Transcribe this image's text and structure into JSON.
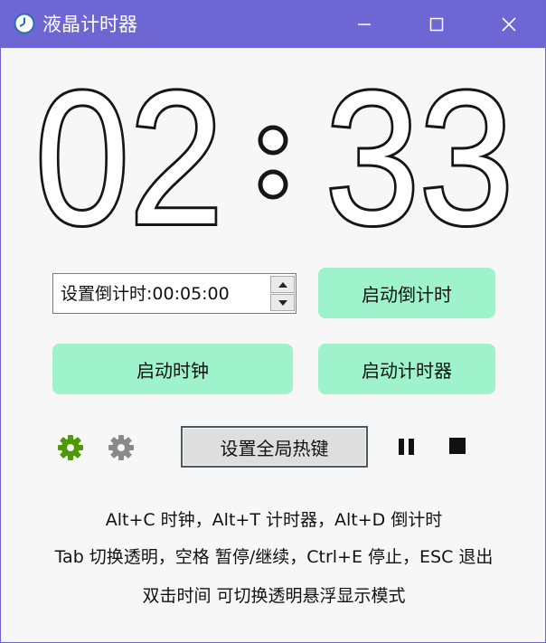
{
  "window": {
    "title": "液晶计时器",
    "controls": {
      "minimize_icon": "minimize-icon",
      "maximize_icon": "maximize-icon",
      "close_icon": "close-icon"
    },
    "accent": "#6e66d2"
  },
  "display": {
    "hours_minutes_left": "02",
    "separator": ":",
    "seconds_right": "33"
  },
  "countdown": {
    "spinbox_value": "设置倒计时:00:05:00",
    "start_label": "启动倒计时"
  },
  "buttons": {
    "start_clock": "启动时钟",
    "start_timer": "启动计时器",
    "set_hotkeys": "设置全局热键",
    "color": "#9ef2cc"
  },
  "toolbar": {
    "settings_green_icon": "gear-icon",
    "settings_gray_icon": "gear-icon",
    "pause_icon": "pause-icon",
    "stop_icon": "stop-icon",
    "green": "#4e9a06"
  },
  "help": {
    "line1": "Alt+C 时钟，Alt+T 计时器，Alt+D 倒计时",
    "line2": "Tab 切换透明，空格 暂停/继续，Ctrl+E 停止，ESC 退出",
    "line3": "双击时间 可切换透明悬浮显示模式"
  }
}
